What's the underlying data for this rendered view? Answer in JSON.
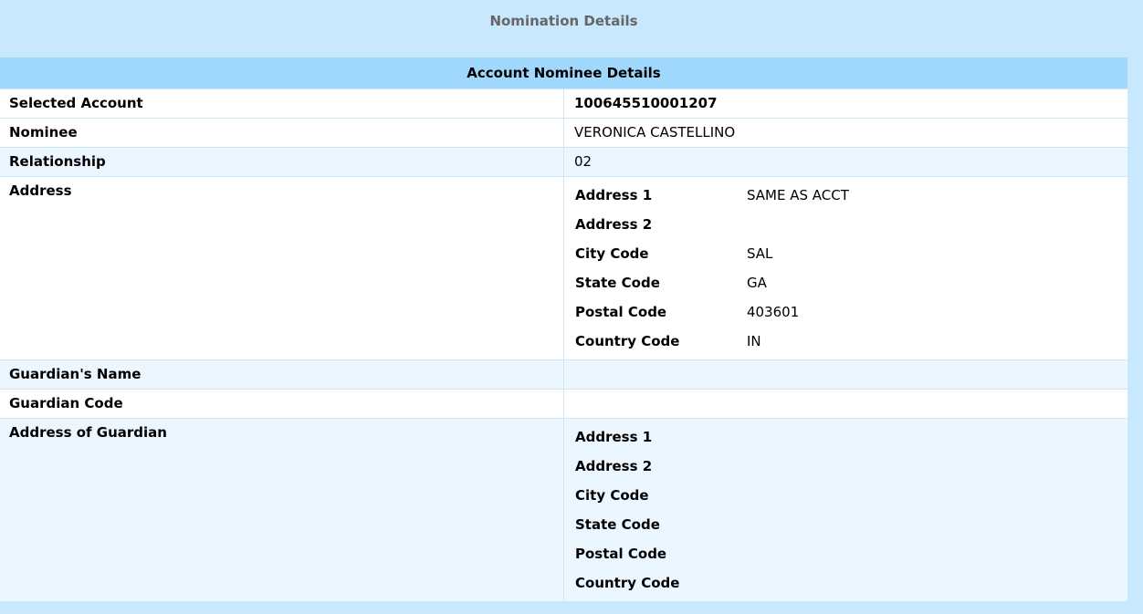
{
  "page_title": "Nomination Details",
  "section_title": "Account Nominee Details",
  "rows": {
    "selected_account": {
      "label": "Selected Account",
      "value": "100645510001207"
    },
    "nominee": {
      "label": "Nominee",
      "value": "VERONICA CASTELLINO"
    },
    "relationship": {
      "label": "Relationship",
      "value": "02"
    },
    "address": {
      "label": "Address"
    },
    "guardian_name": {
      "label": "Guardian's Name",
      "value": ""
    },
    "guardian_code": {
      "label": "Guardian Code",
      "value": ""
    },
    "guardian_address": {
      "label": "Address of Guardian"
    }
  },
  "nominee_address": [
    {
      "label": "Address 1",
      "value": "SAME AS ACCT"
    },
    {
      "label": "Address 2",
      "value": ""
    },
    {
      "label": "City Code",
      "value": "SAL"
    },
    {
      "label": "State Code",
      "value": "GA"
    },
    {
      "label": "Postal Code",
      "value": "403601"
    },
    {
      "label": "Country Code",
      "value": "IN"
    }
  ],
  "guardian_address": [
    {
      "label": "Address 1",
      "value": ""
    },
    {
      "label": "Address 2",
      "value": ""
    },
    {
      "label": "City Code",
      "value": ""
    },
    {
      "label": "State Code",
      "value": ""
    },
    {
      "label": "Postal Code",
      "value": ""
    },
    {
      "label": "Country Code",
      "value": ""
    }
  ]
}
